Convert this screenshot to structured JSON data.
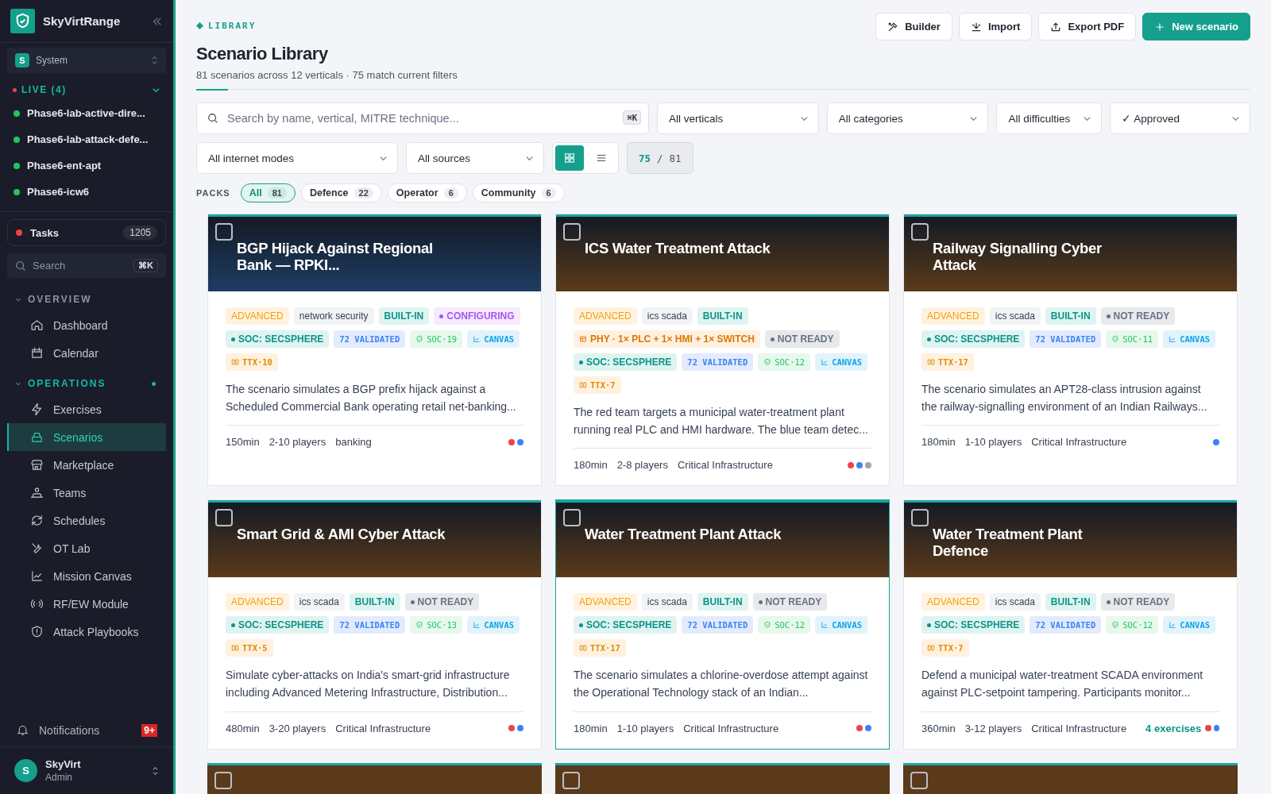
{
  "sidebar": {
    "brand": "SkyVirtRange",
    "workspace": {
      "avatar": "S",
      "name": "System"
    },
    "live": {
      "label": "LIVE (4)",
      "expanded": true,
      "items": [
        {
          "label": "Phase6-lab-active-dire...",
          "color": "#22c55e"
        },
        {
          "label": "Phase6-lab-attack-defe...",
          "color": "#22c55e"
        },
        {
          "label": "Phase6-ent-apt",
          "color": "#22c55e"
        },
        {
          "label": "Phase6-icw6",
          "color": "#22c55e"
        }
      ]
    },
    "tasks": {
      "label": "Tasks",
      "count": "1205"
    },
    "search": {
      "placeholder": "Search",
      "shortcut": "⌘K"
    },
    "sections": [
      {
        "label": "OVERVIEW",
        "expanded": true,
        "items": [
          {
            "label": "Dashboard",
            "selected": false
          },
          {
            "label": "Calendar",
            "selected": false
          }
        ]
      },
      {
        "label": "OPERATIONS",
        "expanded": true,
        "dot": true,
        "items": [
          {
            "label": "Exercises",
            "selected": false
          },
          {
            "label": "Scenarios",
            "selected": true
          },
          {
            "label": "Marketplace",
            "selected": false
          },
          {
            "label": "Teams",
            "selected": false
          },
          {
            "label": "Schedules",
            "selected": false
          },
          {
            "label": "OT Lab",
            "selected": false
          },
          {
            "label": "Mission Canvas",
            "selected": false
          },
          {
            "label": "RF/EW Module",
            "selected": false
          },
          {
            "label": "Attack Playbooks",
            "selected": false
          }
        ]
      }
    ],
    "notifications": {
      "label": "Notifications",
      "badge": "9+"
    },
    "user": {
      "avatar": "S",
      "name": "SkyVirt",
      "role": "Admin"
    }
  },
  "header": {
    "eyebrow": "LIBRARY",
    "title": "Scenario Library",
    "subtitle": "81 scenarios across 12 verticals · 75 match current filters",
    "buttons": [
      {
        "label": "Builder",
        "kind": "tools"
      },
      {
        "label": "Import",
        "kind": "import"
      },
      {
        "label": "Export PDF",
        "kind": "export"
      },
      {
        "label": "New scenario",
        "kind": "primary"
      }
    ]
  },
  "filters": {
    "search": {
      "placeholder": "Search by name, vertical, MITRE technique...",
      "shortcut": "⌘K"
    },
    "row1": [
      "All verticals",
      "All categories",
      "All difficulties",
      "✓ Approved"
    ],
    "row2": [
      "All internet modes",
      "All sources"
    ],
    "views": [
      {
        "kind": "grid",
        "selected": true
      },
      {
        "kind": "list",
        "selected": false
      }
    ],
    "count": {
      "shown": "75",
      "sep": "/",
      "total": "81"
    }
  },
  "packs": {
    "label": "PACKS",
    "chips": [
      {
        "label": "All",
        "count": "81",
        "selected": true
      },
      {
        "label": "Defence",
        "count": "22",
        "selected": false
      },
      {
        "label": "Operator",
        "count": "6",
        "selected": false
      },
      {
        "label": "Community",
        "count": "6",
        "selected": false
      }
    ]
  },
  "cards": [
    {
      "title": "BGP Hijack Against Regional Bank — RPKI...",
      "color": "#1e3d63",
      "checked": false,
      "selected": false,
      "tags": [
        {
          "kind": "difficulty",
          "text": "ADVANCED"
        },
        {
          "kind": "vertical",
          "text": "network security"
        },
        {
          "kind": "builtin",
          "text": "BUILT-IN"
        },
        {
          "kind": "configuring",
          "text": "CONFIGURING"
        },
        {
          "kind": "soc",
          "text": "SOC: SECSPHERE"
        },
        {
          "kind": "validated",
          "text": "72 VALIDATED"
        },
        {
          "kind": "socnum",
          "text": "SOC·19"
        },
        {
          "kind": "canvas",
          "text": "CANVAS"
        },
        {
          "kind": "ttx",
          "text": "TTX·10"
        }
      ],
      "description": "The scenario simulates a BGP prefix hijack against a Scheduled Commercial Bank operating retail net-banking...",
      "duration": "150min",
      "players": "2-10 players",
      "vertical": "banking",
      "dots": [
        {
          "color": "#ef4444"
        },
        {
          "color": "#3b82f6"
        }
      ]
    },
    {
      "title": "ICS Water Treatment Attack",
      "color": "#5a3a1a",
      "checked": false,
      "selected": false,
      "tags": [
        {
          "kind": "difficulty",
          "text": "ADVANCED"
        },
        {
          "kind": "vertical",
          "text": "ics scada"
        },
        {
          "kind": "builtin",
          "text": "BUILT-IN"
        },
        {
          "kind": "phy",
          "text": "PHY · 1× PLC + 1× HMI + 1× SWITCH"
        },
        {
          "kind": "notready",
          "text": "NOT READY"
        },
        {
          "kind": "soc",
          "text": "SOC: SECSPHERE"
        },
        {
          "kind": "validated",
          "text": "72 VALIDATED"
        },
        {
          "kind": "socnum",
          "text": "SOC·12"
        },
        {
          "kind": "canvas",
          "text": "CANVAS"
        },
        {
          "kind": "ttx",
          "text": "TTX·7"
        }
      ],
      "description": "The red team targets a municipal water-treatment plant running real PLC and HMI hardware. The blue team detec...",
      "duration": "180min",
      "players": "2-8 players",
      "vertical": "Critical Infrastructure",
      "dots": [
        {
          "color": "#ef4444"
        },
        {
          "color": "#3b82f6"
        },
        {
          "color": "#9ca3af"
        }
      ]
    },
    {
      "title": "Railway Signalling Cyber Attack",
      "color": "#5a3a1a",
      "checked": false,
      "selected": false,
      "tags": [
        {
          "kind": "difficulty",
          "text": "ADVANCED"
        },
        {
          "kind": "vertical",
          "text": "ics scada"
        },
        {
          "kind": "builtin",
          "text": "BUILT-IN"
        },
        {
          "kind": "notready",
          "text": "NOT READY"
        },
        {
          "kind": "soc",
          "text": "SOC: SECSPHERE"
        },
        {
          "kind": "validated",
          "text": "72 VALIDATED"
        },
        {
          "kind": "socnum",
          "text": "SOC·11"
        },
        {
          "kind": "canvas",
          "text": "CANVAS"
        },
        {
          "kind": "ttx",
          "text": "TTX·17"
        }
      ],
      "description": "The scenario simulates an APT28-class intrusion against the railway-signalling environment of an Indian Railways...",
      "duration": "180min",
      "players": "1-10 players",
      "vertical": "Critical Infrastructure",
      "dots": [
        {
          "color": "#3b82f6"
        }
      ]
    },
    {
      "title": "Smart Grid & AMI Cyber Attack",
      "color": "#5a3a1a",
      "checked": false,
      "selected": false,
      "tags": [
        {
          "kind": "difficulty",
          "text": "ADVANCED"
        },
        {
          "kind": "vertical",
          "text": "ics scada"
        },
        {
          "kind": "builtin",
          "text": "BUILT-IN"
        },
        {
          "kind": "notready",
          "text": "NOT READY"
        },
        {
          "kind": "soc",
          "text": "SOC: SECSPHERE"
        },
        {
          "kind": "validated",
          "text": "72 VALIDATED"
        },
        {
          "kind": "socnum",
          "text": "SOC·13"
        },
        {
          "kind": "canvas",
          "text": "CANVAS"
        },
        {
          "kind": "ttx",
          "text": "TTX·5"
        }
      ],
      "description": "Simulate cyber-attacks on India's smart-grid infrastructure including Advanced Metering Infrastructure, Distribution...",
      "duration": "480min",
      "players": "3-20 players",
      "vertical": "Critical Infrastructure",
      "dots": [
        {
          "color": "#ef4444"
        },
        {
          "color": "#3b82f6"
        }
      ]
    },
    {
      "title": "Water Treatment Plant Attack",
      "color": "#5a3a1a",
      "checked": false,
      "selected": true,
      "tags": [
        {
          "kind": "difficulty",
          "text": "ADVANCED"
        },
        {
          "kind": "vertical",
          "text": "ics scada"
        },
        {
          "kind": "builtin",
          "text": "BUILT-IN"
        },
        {
          "kind": "notready",
          "text": "NOT READY"
        },
        {
          "kind": "soc",
          "text": "SOC: SECSPHERE"
        },
        {
          "kind": "validated",
          "text": "72 VALIDATED"
        },
        {
          "kind": "socnum",
          "text": "SOC·12"
        },
        {
          "kind": "canvas",
          "text": "CANVAS"
        },
        {
          "kind": "ttx",
          "text": "TTX·17"
        }
      ],
      "description": "The scenario simulates a chlorine-overdose attempt against the Operational Technology stack of an Indian...",
      "duration": "180min",
      "players": "1-10 players",
      "vertical": "Critical Infrastructure",
      "dots": [
        {
          "color": "#ef4444"
        },
        {
          "color": "#3b82f6"
        }
      ]
    },
    {
      "title": "Water Treatment Plant Defence",
      "color": "#5a3a1a",
      "checked": false,
      "selected": false,
      "tags": [
        {
          "kind": "difficulty",
          "text": "ADVANCED"
        },
        {
          "kind": "vertical",
          "text": "ics scada"
        },
        {
          "kind": "builtin",
          "text": "BUILT-IN"
        },
        {
          "kind": "notready",
          "text": "NOT READY"
        },
        {
          "kind": "soc",
          "text": "SOC: SECSPHERE"
        },
        {
          "kind": "validated",
          "text": "72 VALIDATED"
        },
        {
          "kind": "socnum",
          "text": "SOC·12"
        },
        {
          "kind": "canvas",
          "text": "CANVAS"
        },
        {
          "kind": "ttx",
          "text": "TTX·7"
        }
      ],
      "description": "Defend a municipal water-treatment SCADA environment against PLC-setpoint tampering. Participants monitor...",
      "duration": "360min",
      "players": "3-12 players",
      "vertical": "Critical Infrastructure",
      "exercises": "4 exercises",
      "dots": [
        {
          "color": "#ef4444"
        },
        {
          "color": "#3b82f6"
        }
      ]
    }
  ],
  "more_cards": [
    {
      "color": "#5a3a1a",
      "checked": false
    },
    {
      "color": "#5a3a1a",
      "checked": false
    },
    {
      "color": "#5a3a1a",
      "checked": false
    }
  ]
}
